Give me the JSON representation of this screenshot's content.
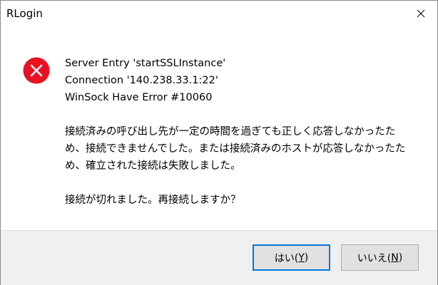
{
  "window": {
    "title": "RLogin",
    "close_icon": "close-icon"
  },
  "message": {
    "icon": "error-icon",
    "icon_color": "#e81123",
    "lines_info": [
      "Server Entry 'startSSLInstance'",
      "Connection '140.238.33.1:22'",
      "WinSock Have Error #10060"
    ],
    "lines_detail": [
      "接続済みの呼び出し先が一定の時間を過ぎても正しく応答しなかったた",
      "め、接続できませんでした。または接続済みのホストが応答しなかったた",
      "め、確立された接続は失敗しました。"
    ],
    "question": "接続が切れました。再接続しますか？"
  },
  "buttons": {
    "yes_label": "はい(",
    "yes_mnemonic": "Y",
    "yes_suffix": ")",
    "no_label": "いいえ(",
    "no_mnemonic": "N",
    "no_suffix": ")"
  },
  "colors": {
    "accent": "#0078d7",
    "footer_bg": "#f0f0f0",
    "button_bg": "#e1e1e1"
  }
}
